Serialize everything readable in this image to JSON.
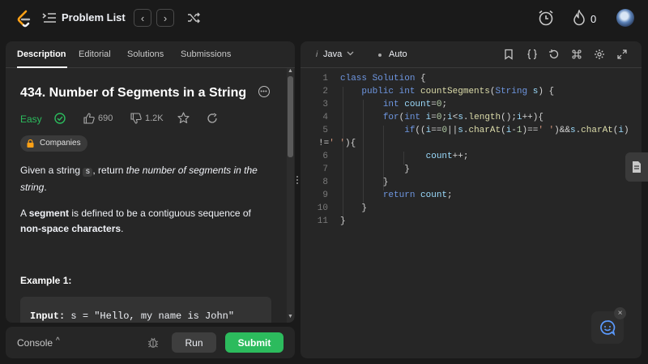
{
  "header": {
    "problem_list_label": "Problem List",
    "prev_label": "‹",
    "next_label": "›",
    "fire_count": "0"
  },
  "left": {
    "tabs": [
      {
        "label": "Description"
      },
      {
        "label": "Editorial"
      },
      {
        "label": "Solutions"
      },
      {
        "label": "Submissions"
      }
    ],
    "title": "434. Number of Segments in a String",
    "difficulty": "Easy",
    "likes": "690",
    "dislikes": "1.2K",
    "companies_label": "Companies",
    "desc1_pre": "Given a string ",
    "desc1_code": "s",
    "desc1_mid": ", return ",
    "desc1_em": "the number of segments in the string",
    "desc1_post": ".",
    "desc2_pre": "A ",
    "desc2_bold1": "segment",
    "desc2_mid": " is defined to be a contiguous sequence of ",
    "desc2_bold2": "non-space characters",
    "desc2_post": ".",
    "example_title": "Example 1:",
    "example_input_label": "Input:",
    "example_input_value": " s = \"Hello, my name is John\""
  },
  "bottom": {
    "console_label": "Console",
    "run_label": "Run",
    "submit_label": "Submit"
  },
  "editor": {
    "language_prefix": "i",
    "language": "Java",
    "autocomplete": "Auto",
    "line_numbers": [
      "1",
      "2",
      "3",
      "4",
      "5",
      "",
      "6",
      "7",
      "8",
      "9",
      "10",
      "11"
    ]
  },
  "colors": {
    "easy": "#2cbb5d",
    "submit": "#2cbb5d",
    "panel": "#262626",
    "background": "#1a1a1a"
  }
}
